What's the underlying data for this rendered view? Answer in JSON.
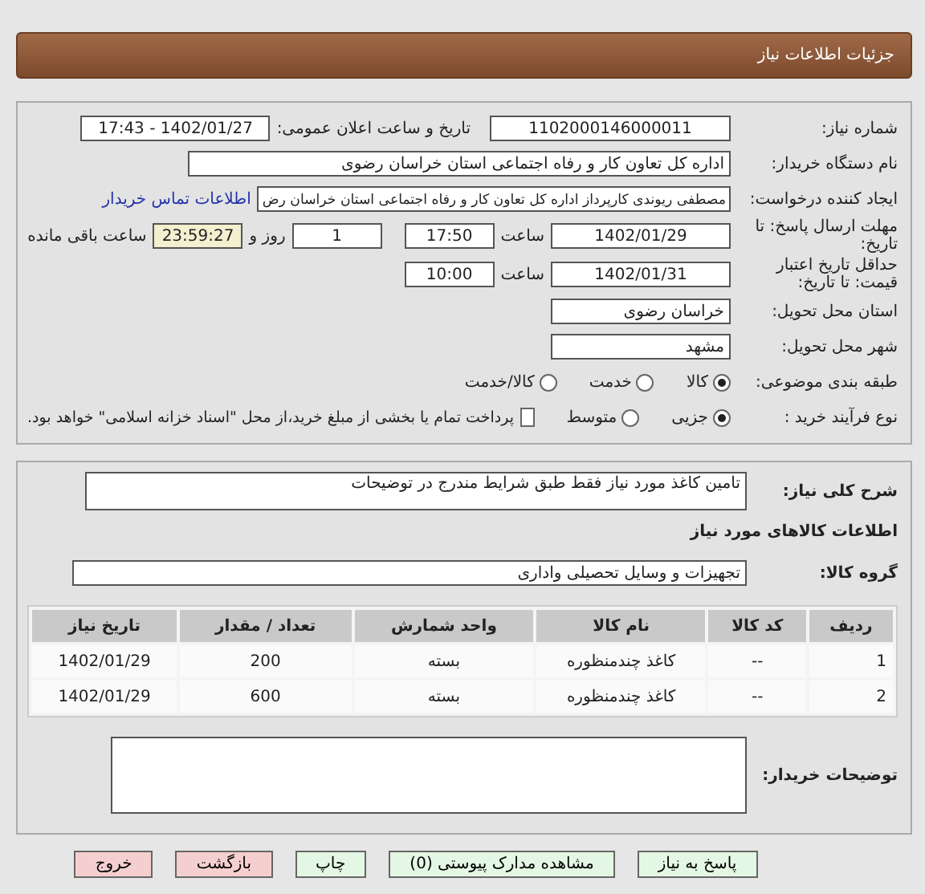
{
  "header": {
    "title": "جزئیات اطلاعات نیاز"
  },
  "need_number": {
    "label": "شماره نیاز:",
    "value": "1102000146000011"
  },
  "announce": {
    "label": "تاریخ و ساعت اعلان عمومی:",
    "value": "1402/01/27 - 17:43"
  },
  "buyer_org": {
    "label": "نام دستگاه خریدار:",
    "value": "اداره کل تعاون  کار و رفاه اجتماعی استان خراسان رضوی"
  },
  "requester": {
    "label": "ایجاد کننده درخواست:",
    "value": "مصطفی  ریوندی کارپرداز اداره کل تعاون  کار و رفاه اجتماعی استان خراسان رض",
    "link": "اطلاعات تماس خریدار"
  },
  "deadline": {
    "label": "مهلت ارسال پاسخ: تا تاریخ:",
    "date": "1402/01/29",
    "time_label": "ساعت",
    "time": "17:50",
    "days": "1",
    "days_label": "روز و",
    "remaining": "23:59:27",
    "remaining_label": "ساعت باقی مانده"
  },
  "validity": {
    "label": "حداقل تاریخ اعتبار قیمت: تا تاریخ:",
    "date": "1402/01/31",
    "time_label": "ساعت",
    "time": "10:00"
  },
  "province": {
    "label": "استان محل تحویل:",
    "value": "خراسان رضوی"
  },
  "city": {
    "label": "شهر محل تحویل:",
    "value": "مشهد"
  },
  "category": {
    "label": "طبقه بندی موضوعی:",
    "options": [
      {
        "label": "کالا",
        "selected": true
      },
      {
        "label": "خدمت",
        "selected": false
      },
      {
        "label": "کالا/خدمت",
        "selected": false
      }
    ]
  },
  "process": {
    "label": "نوع فرآیند خرید :",
    "options": [
      {
        "label": "جزیی",
        "selected": true
      },
      {
        "label": "متوسط",
        "selected": false
      }
    ],
    "payment": {
      "label": "پرداخت تمام یا بخشی از مبلغ خرید،از محل \"اسناد خزانه اسلامی\" خواهد بود.",
      "checked": false
    }
  },
  "description": {
    "label": "شرح کلی نیاز:",
    "value": "تامین کاغذ مورد نیاز فقط طبق شرایط مندرج در توضیحات"
  },
  "goods_heading": "اطلاعات کالاهای مورد نیاز",
  "group": {
    "label": "گروه کالا:",
    "value": "تجهیزات و وسایل تحصیلی واداری"
  },
  "table": {
    "columns": [
      "ردیف",
      "کد کالا",
      "نام کالا",
      "واحد شمارش",
      "تعداد / مقدار",
      "تاریخ نیاز"
    ],
    "rows": [
      [
        "1",
        "--",
        "کاغذ چندمنظوره",
        "بسته",
        "200",
        "1402/01/29"
      ],
      [
        "2",
        "--",
        "کاغذ چندمنظوره",
        "بسته",
        "600",
        "1402/01/29"
      ]
    ]
  },
  "buyer_notes": {
    "label": "توضیحات خریدار:"
  },
  "buttons": [
    {
      "label": "پاسخ به نیاز",
      "kind": "normal"
    },
    {
      "label": "مشاهده مدارک پیوستی (0)",
      "kind": "normal"
    },
    {
      "label": "چاپ",
      "kind": "normal"
    },
    {
      "label": "بازگشت",
      "kind": "danger"
    },
    {
      "label": "خروج",
      "kind": "danger"
    }
  ]
}
